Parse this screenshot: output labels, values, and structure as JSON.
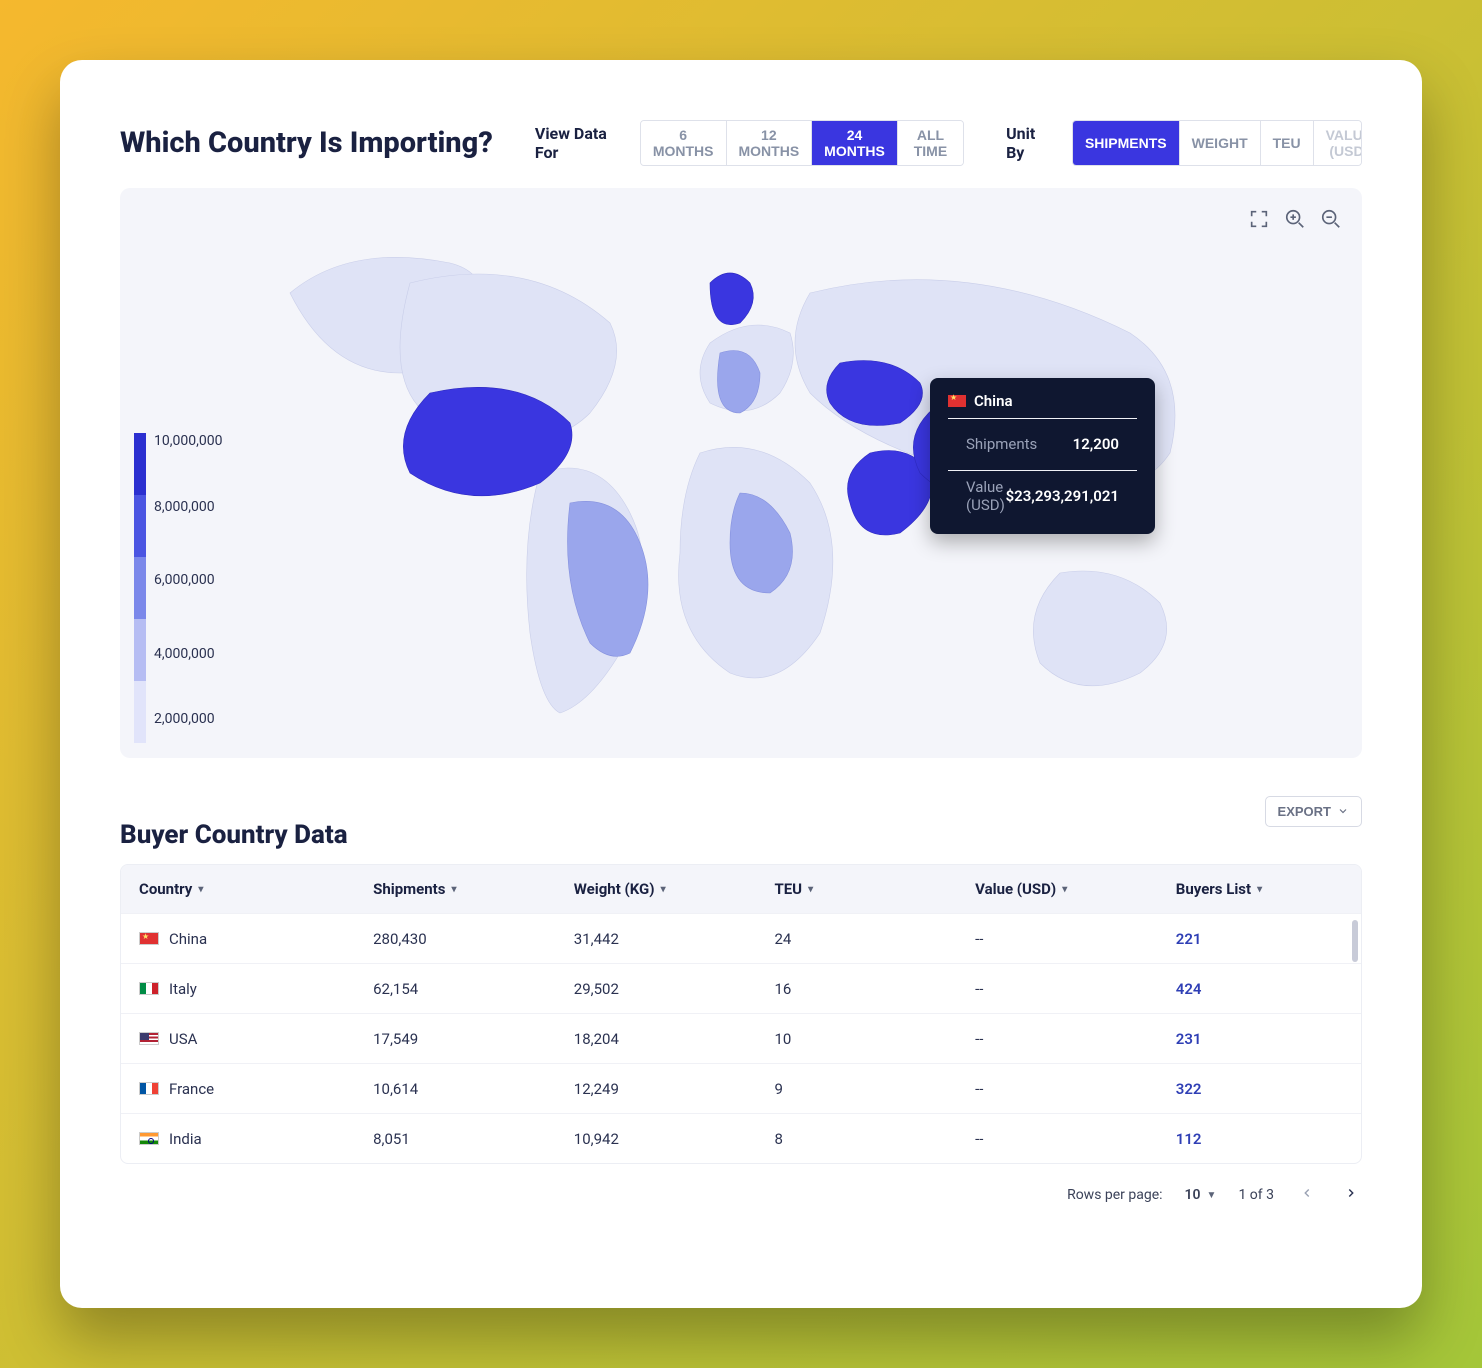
{
  "header": {
    "title": "Which Country Is Importing?",
    "view_data_label": "View Data For",
    "unit_by_label": "Unit By",
    "time_options": [
      "6 MONTHS",
      "12 MONTHS",
      "24 MONTHS",
      "ALL TIME"
    ],
    "time_selected": "24 MONTHS",
    "unit_options": [
      "SHIPMENTS",
      "WEIGHT",
      "TEU",
      "VALUE (USD)"
    ],
    "unit_selected": "SHIPMENTS",
    "unit_disabled": [
      "VALUE (USD)"
    ]
  },
  "map": {
    "legend_ticks": [
      "10,000,000",
      "8,000,000",
      "6,000,000",
      "4,000,000",
      "2,000,000"
    ],
    "legend_colors": [
      "#2b2fd0",
      "#4b55e2",
      "#7b88ea",
      "#b6bdf3",
      "#e1e4fa"
    ],
    "tooltip": {
      "country": "China",
      "shipments_label": "Shipments",
      "shipments_value": "12,200",
      "value_label": "Value (USD)",
      "value_value": "$23,293,291,021"
    }
  },
  "table": {
    "title": "Buyer Country Data",
    "export_label": "EXPORT",
    "columns": [
      "Country",
      "Shipments",
      "Weight (KG)",
      "TEU",
      "Value (USD)",
      "Buyers List"
    ],
    "rows": [
      {
        "flag": "cn",
        "country": "China",
        "shipments": "280,430",
        "weight": "31,442",
        "teu": "24",
        "value": "--",
        "buyers": "221"
      },
      {
        "flag": "it",
        "country": "Italy",
        "shipments": "62,154",
        "weight": "29,502",
        "teu": "16",
        "value": "--",
        "buyers": "424"
      },
      {
        "flag": "us",
        "country": "USA",
        "shipments": "17,549",
        "weight": "18,204",
        "teu": "10",
        "value": "--",
        "buyers": "231"
      },
      {
        "flag": "fr",
        "country": "France",
        "shipments": "10,614",
        "weight": "12,249",
        "teu": "9",
        "value": "--",
        "buyers": "322"
      },
      {
        "flag": "in",
        "country": "India",
        "shipments": "8,051",
        "weight": "10,942",
        "teu": "8",
        "value": "--",
        "buyers": "112"
      }
    ]
  },
  "pagination": {
    "rows_per_page_label": "Rows per page:",
    "rows_per_page_value": "10",
    "page_text": "1 of 3"
  },
  "chart_data": {
    "type": "map",
    "unit": "Shipments",
    "legend_range": [
      2000000,
      10000000
    ],
    "legend_ticks": [
      10000000,
      8000000,
      6000000,
      4000000,
      2000000
    ],
    "hovered_point": {
      "country": "China",
      "shipments": 12200,
      "value_usd": 23293291021
    },
    "table_series": [
      {
        "country": "China",
        "shipments": 280430,
        "weight_kg": 31442,
        "teu": 24,
        "value_usd": null,
        "buyers": 221
      },
      {
        "country": "Italy",
        "shipments": 62154,
        "weight_kg": 29502,
        "teu": 16,
        "value_usd": null,
        "buyers": 424
      },
      {
        "country": "USA",
        "shipments": 17549,
        "weight_kg": 18204,
        "teu": 10,
        "value_usd": null,
        "buyers": 231
      },
      {
        "country": "France",
        "shipments": 10614,
        "weight_kg": 12249,
        "teu": 9,
        "value_usd": null,
        "buyers": 322
      },
      {
        "country": "India",
        "shipments": 8051,
        "weight_kg": 10942,
        "teu": 8,
        "value_usd": null,
        "buyers": 112
      }
    ]
  }
}
